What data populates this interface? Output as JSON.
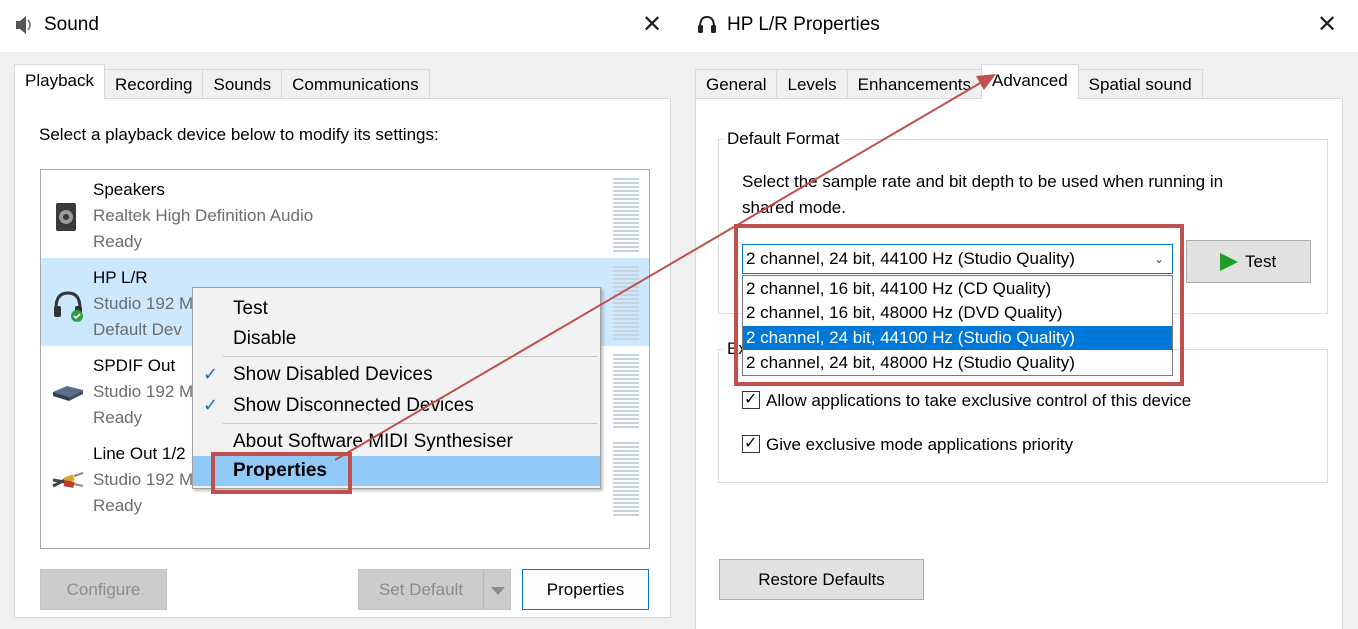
{
  "sound_window": {
    "title": "Sound",
    "close_glyph": "✕",
    "tabs": [
      {
        "label": "Playback",
        "active": true
      },
      {
        "label": "Recording",
        "active": false
      },
      {
        "label": "Sounds",
        "active": false
      },
      {
        "label": "Communications",
        "active": false
      }
    ],
    "instruction": "Select a playback device below to modify its settings:",
    "devices": [
      {
        "name": "Speakers",
        "description": "Realtek High Definition Audio",
        "status": "Ready",
        "icon": "speaker-icon",
        "selected": false
      },
      {
        "name": "HP L/R",
        "description": "Studio 192 M",
        "status": "Default Dev",
        "icon": "headphones-icon",
        "selected": true
      },
      {
        "name": "SPDIF Out",
        "description": "Studio 192 M",
        "status": "Ready",
        "icon": "spdif-icon",
        "selected": false
      },
      {
        "name": "Line Out 1/2",
        "description": "Studio 192 M",
        "status": "Ready",
        "icon": "rca-cable-icon",
        "selected": false
      }
    ],
    "context_menu": {
      "test": "Test",
      "disable": "Disable",
      "show_disabled": "Show Disabled Devices",
      "show_disconnected": "Show Disconnected Devices",
      "about_midi": "About Software MIDI Synthesiser",
      "properties": "Properties"
    },
    "buttons": {
      "configure": "Configure",
      "set_default": "Set Default",
      "properties": "Properties"
    }
  },
  "props_window": {
    "title": "HP L/R Properties",
    "close_glyph": "✕",
    "tabs": [
      {
        "label": "General",
        "active": false
      },
      {
        "label": "Levels",
        "active": false
      },
      {
        "label": "Enhancements",
        "active": false
      },
      {
        "label": "Advanced",
        "active": true
      },
      {
        "label": "Spatial sound",
        "active": false
      }
    ],
    "default_format": {
      "label": "Default Format",
      "description_line1": "Select the sample rate and bit depth to be used when running in",
      "description_line2": "shared mode.",
      "selected": "2 channel, 24 bit, 44100 Hz (Studio Quality)",
      "options": [
        "2 channel, 16 bit, 44100 Hz (CD Quality)",
        "2 channel, 16 bit, 48000 Hz (DVD Quality)",
        "2 channel, 24 bit, 44100 Hz (Studio Quality)",
        "2 channel, 24 bit, 48000 Hz (Studio Quality)"
      ],
      "test_button": "Test"
    },
    "exclusive_mode": {
      "label_visible": "Ex",
      "allow_exclusive": "Allow applications to take exclusive control of this device",
      "give_priority": "Give exclusive mode applications priority"
    },
    "restore_defaults": "Restore Defaults"
  },
  "annotation_color": "#c0504d"
}
